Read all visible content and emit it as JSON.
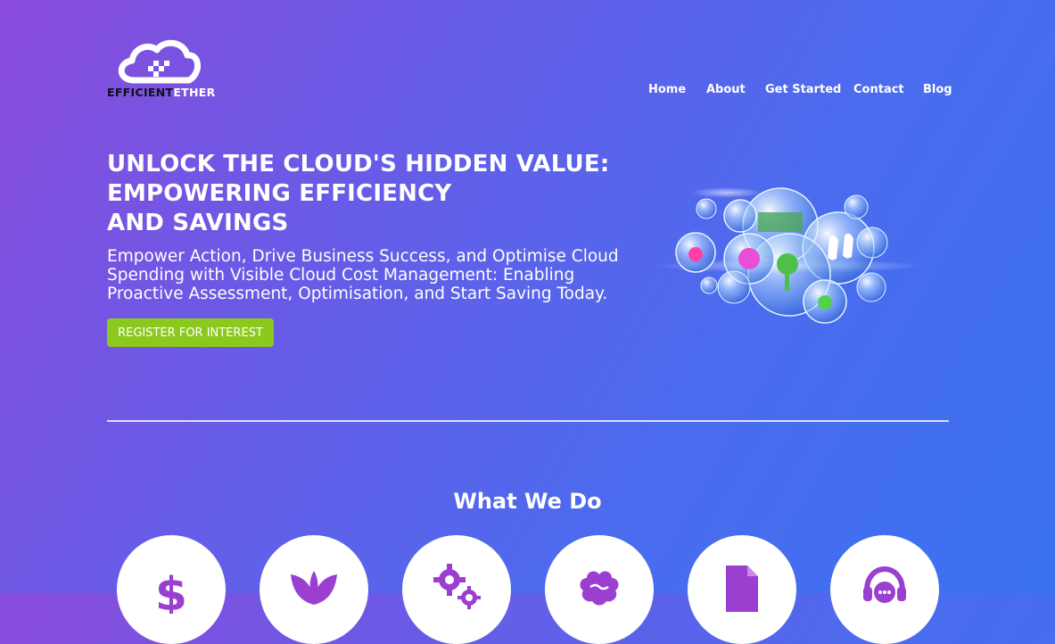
{
  "header": {
    "brand_part1": "EFFICIENT",
    "brand_part2": "ETHER",
    "nav": [
      "Home",
      "About",
      "Get Started",
      "Contact",
      "Blog"
    ]
  },
  "hero": {
    "title_line1": "UNLOCK THE CLOUD'S HIDDEN VALUE:",
    "title_line2": "EMPOWERING EFFICIENCY",
    "title_line3": "AND SAVINGS",
    "subtitle": "Empower Action, Drive Business Success, and Optimise Cloud Spending with Visible Cloud Cost Management: Enabling Proactive Assessment, Optimisation, and Start Saving Today.",
    "cta_label": "REGISTER FOR INTEREST"
  },
  "what_we_do": {
    "title": "What We Do",
    "icons": [
      "dollar-icon",
      "leaf-icon",
      "gears-icon",
      "brain-icon",
      "document-icon",
      "support-chat-icon"
    ]
  },
  "colors": {
    "accent_green": "#8cc91e",
    "icon_purple": "#9b3fd1"
  }
}
